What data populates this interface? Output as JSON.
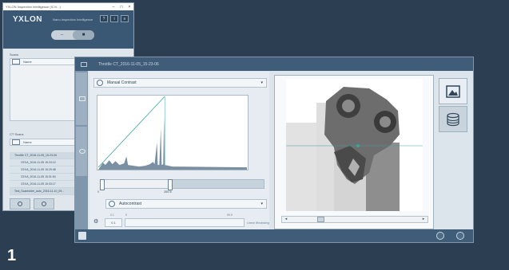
{
  "figure_number": "1",
  "back_window": {
    "title": "YXLON Inspection Intelligence (IC/V...)",
    "controls": [
      "–",
      "□",
      "×"
    ],
    "logo": "YXLON",
    "subtitle": "Nano-inspection Intelligence",
    "header_buttons": [
      "?",
      "i",
      "≡"
    ],
    "toggle": {
      "left": "–",
      "right": "■"
    },
    "panel_label": "Scans",
    "name_header": "Name",
    "ct_label": "CT Scans",
    "ct_name_header": "Name",
    "scans": [
      "Throttle CT_2016-11-05_15-23-06",
      "CEXA_2016-11-05 15:24:12",
      "CEXA_2016-11-05 15:29:48",
      "CEXA_2016-11-05 15:31:54",
      "CEXA_2016-11-05 15:33:17",
      "Test_Scanfolder_auto_2016-11-10_09..."
    ]
  },
  "front_window": {
    "title": "Throttle CT_2016-11-05_15-23-06",
    "contrast_mode": "Manual Contrast",
    "autocontrast_label": "Autocontrast",
    "slider_min": "0",
    "slider_max": "28076",
    "autocontrast_value": "0.1",
    "field_label_a": "0.1",
    "field_label_b": "0",
    "field_label_c": "99.9",
    "field_right": "Linear Windowing"
  },
  "icons": {
    "image_tool": "image-icon",
    "volume_tool": "stack-icon",
    "dropdown_arrow": "chevron-down-icon"
  },
  "colors": {
    "background": "#2c3f52",
    "header": "#3f5d78",
    "accent_line": "#38a59a"
  }
}
